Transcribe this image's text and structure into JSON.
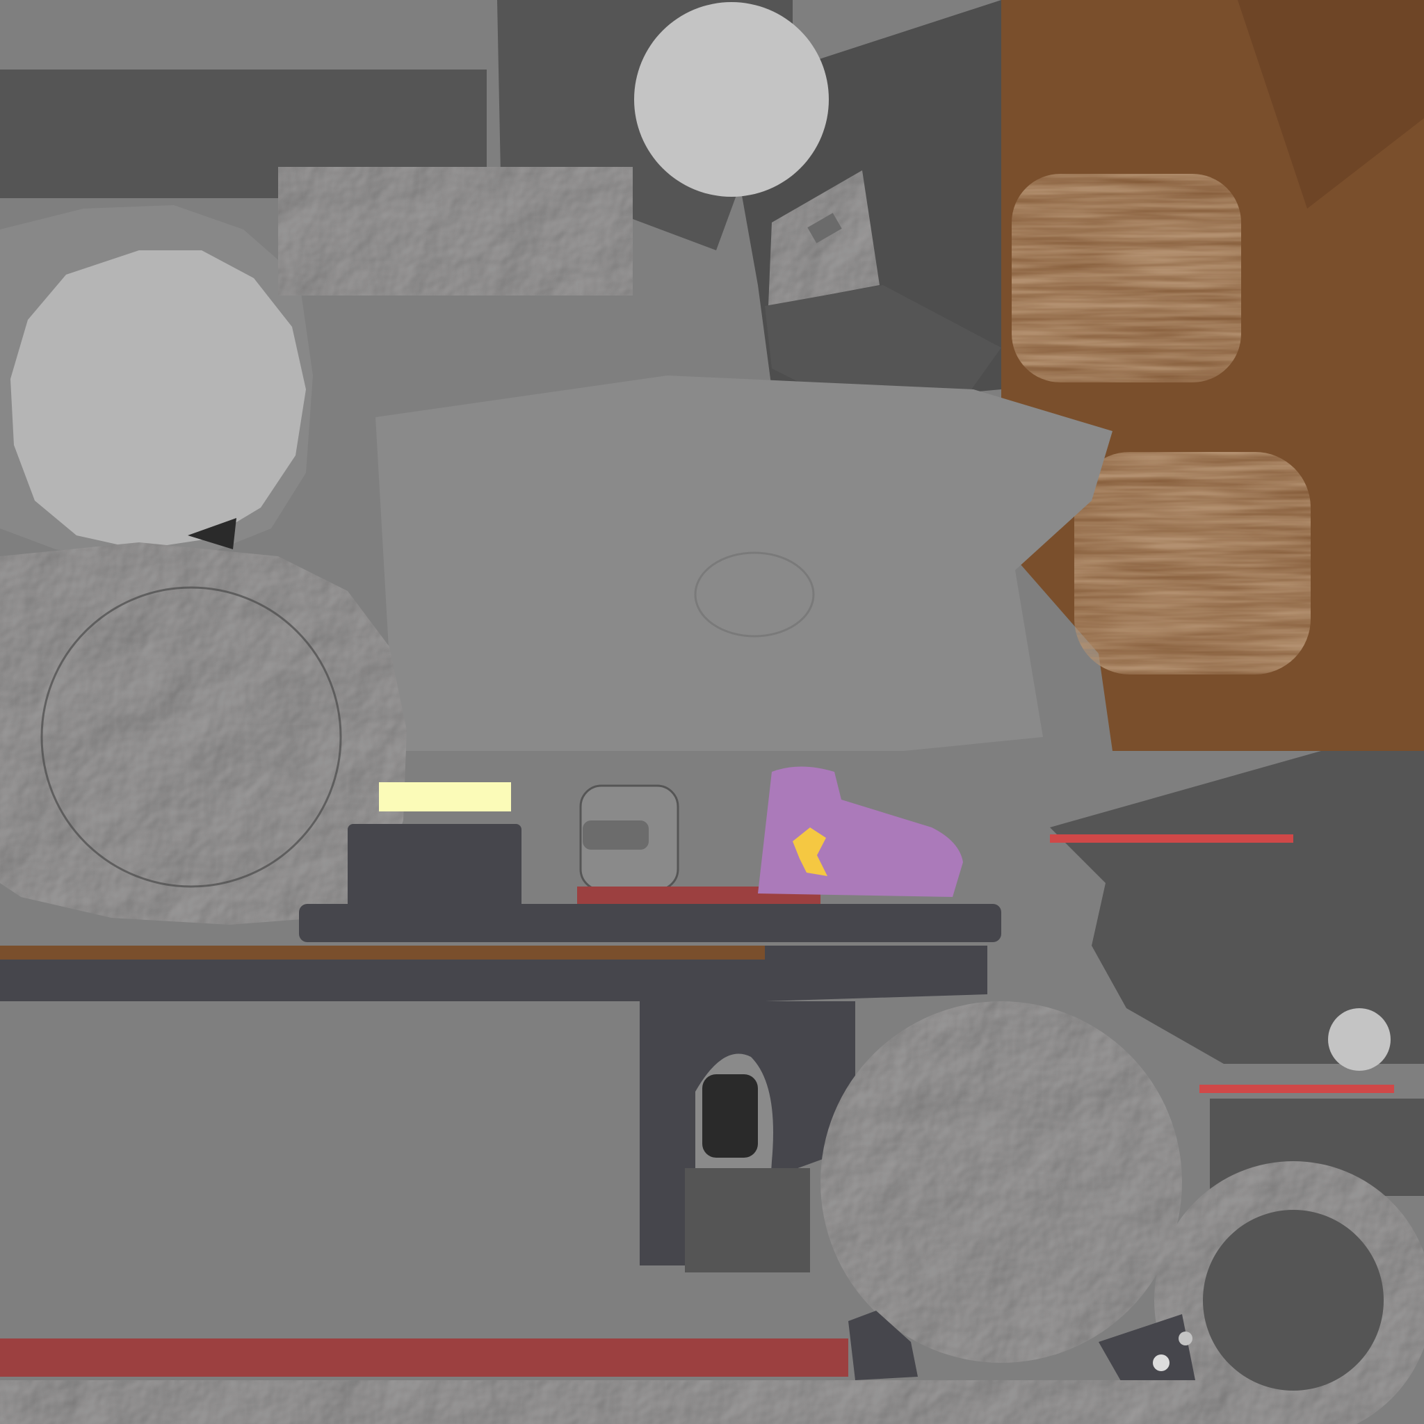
{
  "texture_atlas": {
    "colors": {
      "background": "#7f7f7f",
      "light_gray": "#c4c4c4",
      "mid_gray": "#8a8a8a",
      "dark_gray": "#555555",
      "charcoal": "#46464c",
      "near_black": "#2a2a2a",
      "wood": "#7a4f2c",
      "wood_light": "#8a5a33",
      "red_strip": "#9c4040",
      "red_line": "#d04848",
      "purple": "#ab7aba",
      "yellow_logo": "#f5c842",
      "pale_yellow": "#fbfbb8",
      "paper": "#9a9898"
    },
    "textures": [
      "crumpled-paper",
      "wood-grain"
    ]
  }
}
